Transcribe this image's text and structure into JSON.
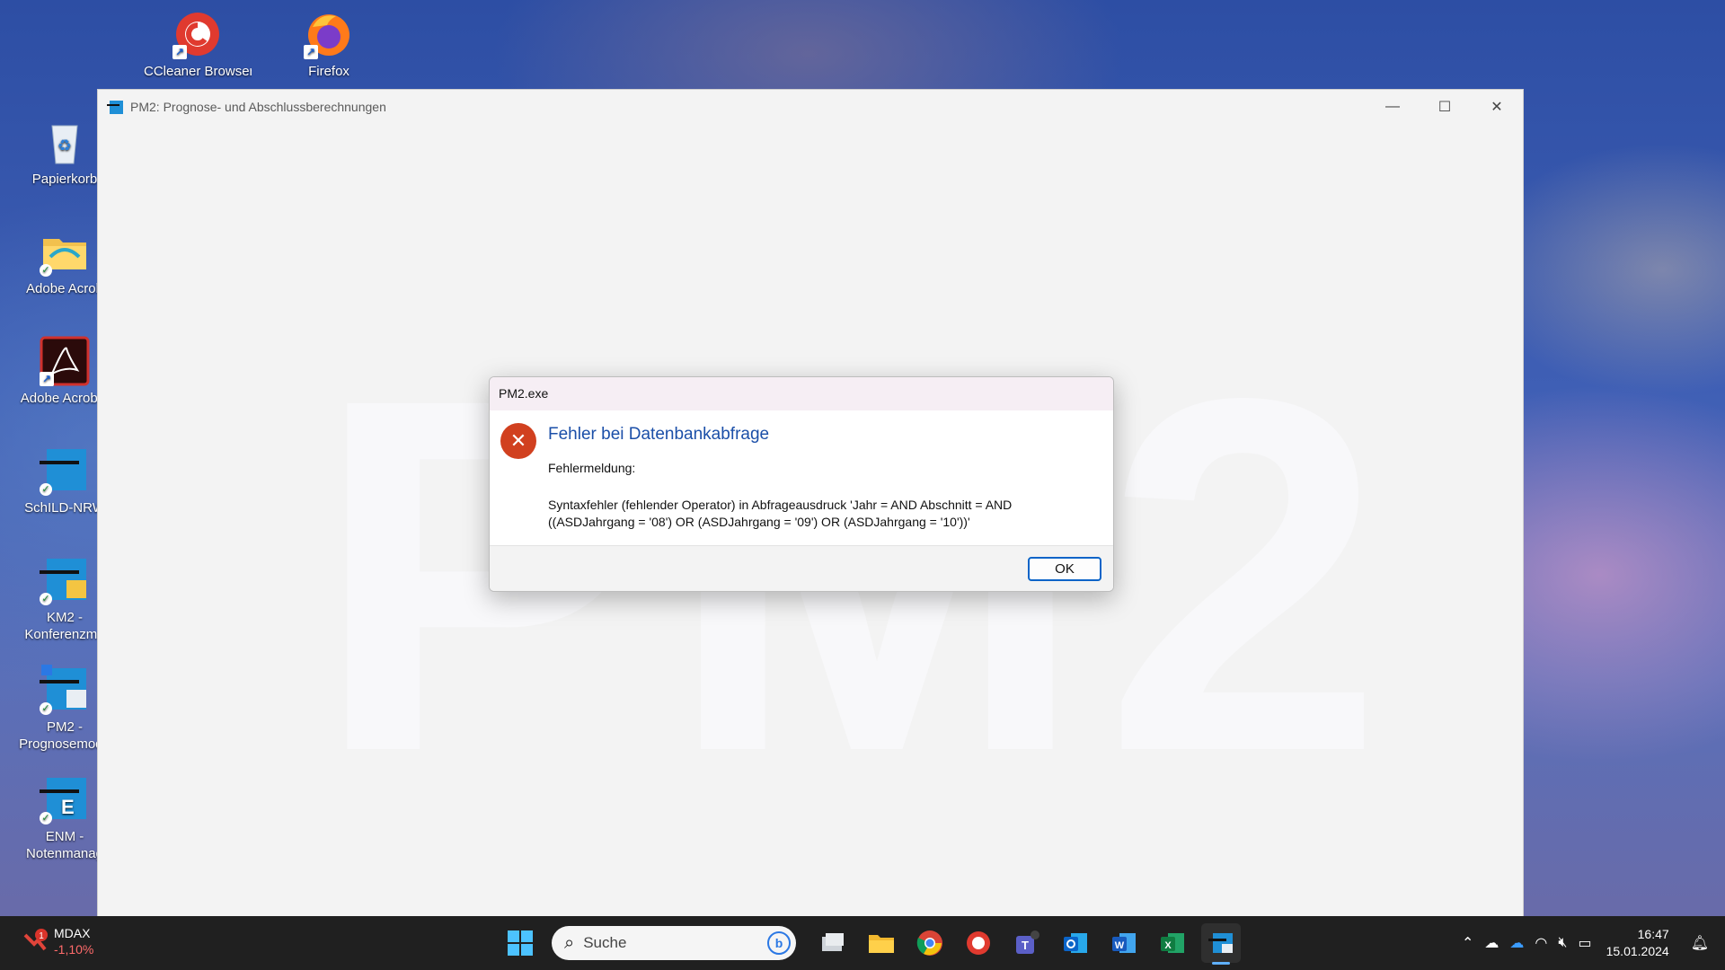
{
  "desktop": {
    "icons": [
      {
        "label": "CCleaner Browser",
        "icon": "ccleaner-browser-icon"
      },
      {
        "label": "Firefox",
        "icon": "firefox-icon"
      },
      {
        "label": "Papierkorb",
        "icon": "recycle-bin-icon"
      },
      {
        "label": "Adobe Acrob",
        "icon": "folder-icon"
      },
      {
        "label": "Adobe Acrobat",
        "icon": "adobe-acrobat-icon"
      },
      {
        "label": "SchILD-NRW",
        "icon": "schild-nrw-icon"
      },
      {
        "label": "KM2 -",
        "label2": "Konferenzmo",
        "icon": "km2-icon"
      },
      {
        "label": "PM2 -",
        "label2": "Prognosemodu",
        "icon": "pm2-icon"
      },
      {
        "label": "ENM -",
        "label2": "Notenmanag",
        "icon": "enm-icon"
      }
    ]
  },
  "window": {
    "title": "PM2: Prognose- und Abschlussberechnungen",
    "watermark": "PM2"
  },
  "dialog": {
    "title": "PM2.exe",
    "heading": "Fehler bei Datenbankabfrage",
    "label": "Fehlermeldung:",
    "message_line1": "Syntaxfehler (fehlender Operator) in Abfrageausdruck 'Jahr =  AND Abschnitt =  AND",
    "message_line2": "((ASDJahrgang = '08') OR  (ASDJahrgang = '09') OR  (ASDJahrgang = '10'))'",
    "ok_label": "OK"
  },
  "taskbar": {
    "stock": {
      "badge": "1",
      "name": "MDAX",
      "value": "-1,10%"
    },
    "search_placeholder": "Suche",
    "time": "16:47",
    "date": "15.01.2024"
  },
  "colors": {
    "accent": "#0a64c8",
    "error": "#d1401f",
    "heading": "#1b4fa8"
  }
}
